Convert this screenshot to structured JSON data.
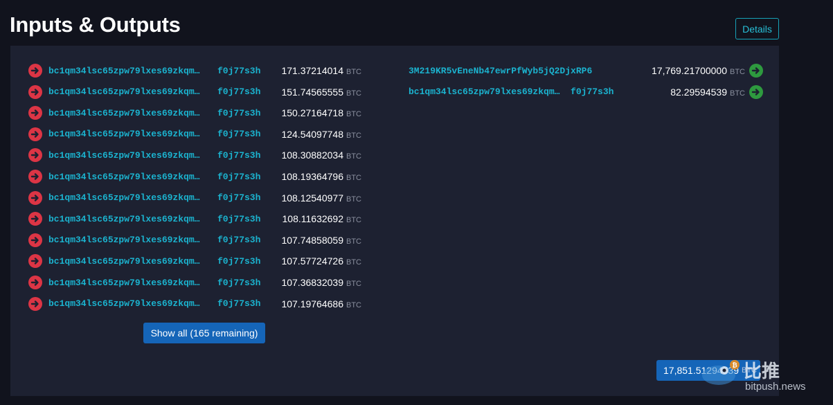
{
  "header": {
    "title": "Inputs & Outputs",
    "details_label": "Details"
  },
  "unit": "BTC",
  "inputs": [
    {
      "address_start": "bc1qm34lsc65zpw79lxes69zkqm…",
      "address_end": "f0j77s3h",
      "amount": "171.37214014"
    },
    {
      "address_start": "bc1qm34lsc65zpw79lxes69zkqm…",
      "address_end": "f0j77s3h",
      "amount": "151.74565555"
    },
    {
      "address_start": "bc1qm34lsc65zpw79lxes69zkqm…",
      "address_end": "f0j77s3h",
      "amount": "150.27164718"
    },
    {
      "address_start": "bc1qm34lsc65zpw79lxes69zkqm…",
      "address_end": "f0j77s3h",
      "amount": "124.54097748"
    },
    {
      "address_start": "bc1qm34lsc65zpw79lxes69zkqm…",
      "address_end": "f0j77s3h",
      "amount": "108.30882034"
    },
    {
      "address_start": "bc1qm34lsc65zpw79lxes69zkqm…",
      "address_end": "f0j77s3h",
      "amount": "108.19364796"
    },
    {
      "address_start": "bc1qm34lsc65zpw79lxes69zkqm…",
      "address_end": "f0j77s3h",
      "amount": "108.12540977"
    },
    {
      "address_start": "bc1qm34lsc65zpw79lxes69zkqm…",
      "address_end": "f0j77s3h",
      "amount": "108.11632692"
    },
    {
      "address_start": "bc1qm34lsc65zpw79lxes69zkqm…",
      "address_end": "f0j77s3h",
      "amount": "107.74858059"
    },
    {
      "address_start": "bc1qm34lsc65zpw79lxes69zkqm…",
      "address_end": "f0j77s3h",
      "amount": "107.57724726"
    },
    {
      "address_start": "bc1qm34lsc65zpw79lxes69zkqm…",
      "address_end": "f0j77s3h",
      "amount": "107.36832039"
    },
    {
      "address_start": "bc1qm34lsc65zpw79lxes69zkqm…",
      "address_end": "f0j77s3h",
      "amount": "107.19764686"
    }
  ],
  "outputs": [
    {
      "address": "3M219KR5vEneNb47ewrPfWyb5jQ2DjxRP6",
      "amount": "17,769.21700000"
    },
    {
      "address": "bc1qm34lsc65zpw79lxes69zkqm…  f0j77s3h",
      "amount": "82.29594539"
    }
  ],
  "show_all_label": "Show all (165 remaining)",
  "total": {
    "amount": "17,851.51294539",
    "unit": "BTC"
  },
  "watermark": {
    "chinese": "比推",
    "url": "bitpush.news"
  },
  "colors": {
    "background": "#11131d",
    "panel": "#1d2131",
    "address": "#1bb3cf",
    "input_icon": "#dc3545",
    "output_icon": "#2e9a3f",
    "button": "#1565b8"
  },
  "icons": {
    "input": "arrow-right-circle-icon",
    "output": "arrow-right-circle-icon"
  }
}
